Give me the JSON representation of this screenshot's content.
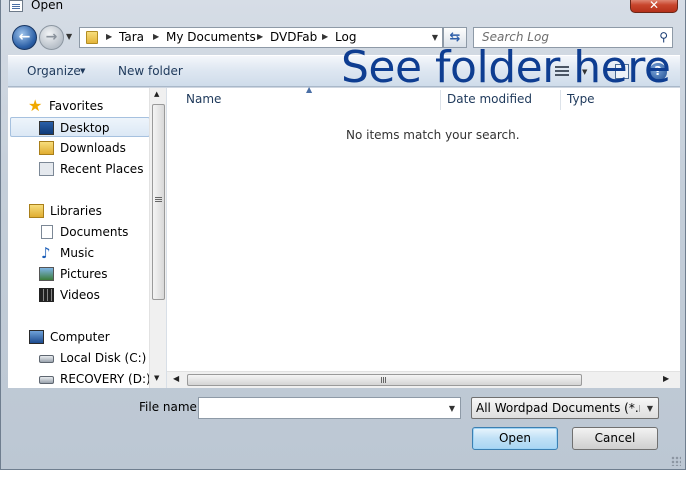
{
  "window": {
    "title": "Open",
    "close_label": "✕"
  },
  "address_bar": {
    "crumbs": [
      "Tara",
      "My Documents",
      "DVDFab",
      "Log"
    ]
  },
  "search": {
    "placeholder": "Search Log"
  },
  "toolbar": {
    "organize_label": "Organize",
    "new_folder_label": "New folder",
    "help_label": "?"
  },
  "annotation": {
    "text": "See folder here"
  },
  "nav": {
    "favorites": {
      "label": "Favorites",
      "items": [
        "Desktop",
        "Downloads",
        "Recent Places"
      ]
    },
    "libraries": {
      "label": "Libraries",
      "items": [
        "Documents",
        "Music",
        "Pictures",
        "Videos"
      ]
    },
    "computer": {
      "label": "Computer",
      "items": [
        "Local Disk (C:)",
        "RECOVERY (D:)"
      ]
    },
    "selected": "Desktop"
  },
  "file_list": {
    "columns": [
      "Name",
      "Date modified",
      "Type"
    ],
    "empty_message": "No items match your search."
  },
  "footer": {
    "file_name_label": "File name:",
    "file_name_value": "",
    "file_type_value": "All Wordpad Documents (*.rtf, *",
    "open_label": "Open",
    "cancel_label": "Cancel"
  }
}
